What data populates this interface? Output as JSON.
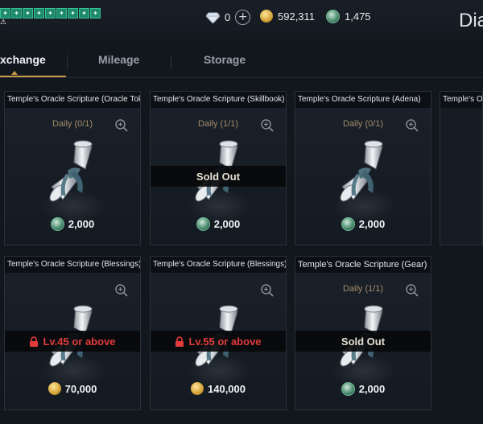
{
  "header": {
    "diamonds": "0",
    "adena": "592,311",
    "coins": "1,475",
    "title_partial": "Dia",
    "buff_icons": [
      "buff-icon",
      "buff-icon",
      "buff-icon",
      "buff-icon",
      "buff-icon",
      "buff-icon",
      "buff-icon",
      "buff-icon",
      "buff-icon"
    ]
  },
  "tabs": [
    {
      "label": "xchange",
      "active": true
    },
    {
      "label": "Mileage",
      "active": false
    },
    {
      "label": "Storage",
      "active": false
    }
  ],
  "cards": [
    {
      "title": "Temple's Oracle Scripture (Oracle Token)",
      "daily": "Daily (0/1)",
      "price": "2,000",
      "currency": "gem",
      "banner": ""
    },
    {
      "title": "Temple's Oracle Scripture (Skillbook)",
      "daily": "Daily (1/1)",
      "price": "2,000",
      "currency": "gem",
      "banner": "Sold Out"
    },
    {
      "title": "Temple's Oracle Scripture (Adena)",
      "daily": "Daily (0/1)",
      "price": "2,000",
      "currency": "gem",
      "banner": ""
    },
    {
      "title": "Temple's Oracle Scripture (Blessings)",
      "daily": "",
      "price": "70,000",
      "currency": "coin",
      "banner": "Lv.45 or above"
    },
    {
      "title": "Temple's Oracle Scripture (Blessings)",
      "daily": "",
      "price": "140,000",
      "currency": "coin",
      "banner": "Lv.55 or above"
    },
    {
      "title": "Temple's Oracle Scripture (Gear)",
      "daily": "Daily (1/1)",
      "price": "2,000",
      "currency": "gem",
      "banner": "Sold Out"
    }
  ],
  "partial_card": {
    "title": "Temple's O"
  },
  "colors": {
    "accent": "#c89a4c",
    "locked": "#e23b3b",
    "buff": "#1f8a6a"
  }
}
